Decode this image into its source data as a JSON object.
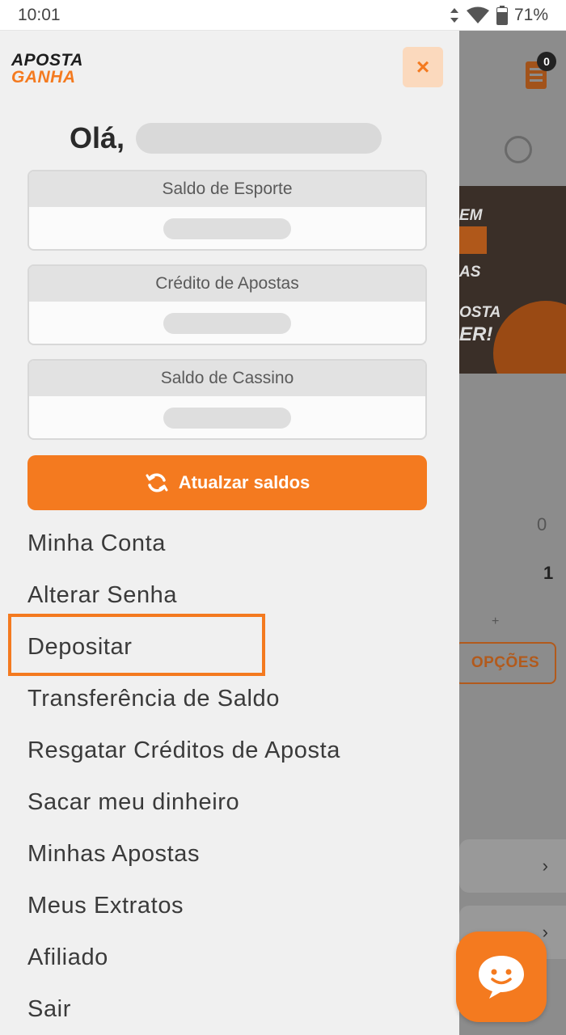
{
  "status_bar": {
    "time": "10:01",
    "battery": "71%"
  },
  "background": {
    "cart_count": "0",
    "num_top": "0",
    "num_bottom": "1",
    "plus": "+",
    "opcoes_label": "OPÇÕES",
    "banner_text_1": "EM",
    "banner_text_2": "AS",
    "banner_text_3": "OSTA",
    "banner_text_4": "ER!"
  },
  "drawer": {
    "logo_line1": "APOSTA",
    "logo_line2": "GANHA",
    "close_icon": "×",
    "greeting": "Olá,",
    "balances": [
      {
        "label": "Saldo de Esporte"
      },
      {
        "label": "Crédito de Apostas"
      },
      {
        "label": "Saldo de Cassino"
      }
    ],
    "refresh_label": "Atualzar saldos",
    "menu": [
      {
        "label": "Minha Conta"
      },
      {
        "label": "Alterar Senha"
      },
      {
        "label": "Depositar"
      },
      {
        "label": "Transferência de Saldo"
      },
      {
        "label": "Resgatar Créditos de Aposta"
      },
      {
        "label": "Sacar meu dinheiro"
      },
      {
        "label": "Minhas Apostas"
      },
      {
        "label": "Meus Extratos"
      },
      {
        "label": "Afiliado"
      },
      {
        "label": "Sair"
      }
    ]
  },
  "colors": {
    "accent": "#f47a1f",
    "drawer_bg": "#f0f0f0",
    "overlay": "#8c8c8c"
  },
  "icons": [
    "signal-icon",
    "wifi-icon",
    "battery-icon",
    "close-icon",
    "refresh-icon",
    "chat-icon",
    "cart-icon",
    "ball-icon",
    "chevron-right-icon"
  ]
}
